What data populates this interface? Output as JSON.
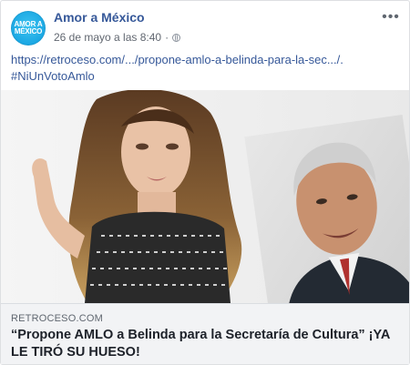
{
  "page": {
    "name": "Amor a México",
    "avatar_text_top": "AMOR A",
    "avatar_text_bottom": "MÉXICO",
    "date": "26 de mayo a las 8:40",
    "separator": "·"
  },
  "post": {
    "link_text": "https://retroceso.com/.../propone-amlo-a-belinda-para-la-sec.../.",
    "hashtag": "#NiUnVotoAmlo"
  },
  "link_preview": {
    "domain": "RETROCESO.COM",
    "title": "“Propone AMLO a Belinda para la Secretaría de Cultura” ¡YA LE TIRÓ SU HUESO!"
  },
  "icons": {
    "privacy": "globe-icon",
    "options": "more-options-icon"
  },
  "colors": {
    "link": "#365899",
    "meta": "#616770",
    "preview_bg": "#f2f3f5",
    "avatar": "#1aa7e3"
  }
}
